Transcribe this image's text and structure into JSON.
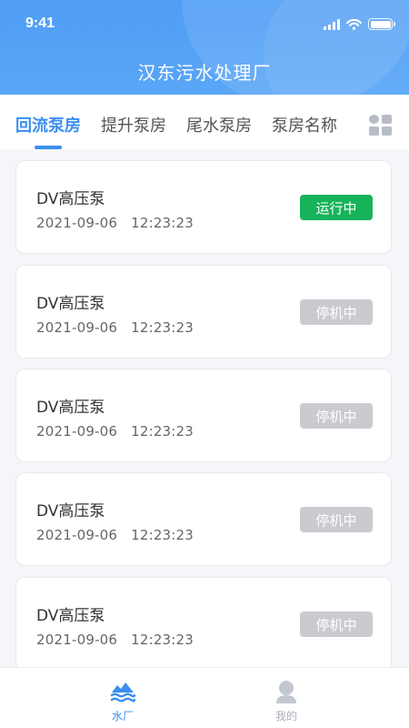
{
  "status_bar": {
    "time": "9:41"
  },
  "header": {
    "title": "汉东污水处理厂"
  },
  "tabs": [
    {
      "label": "回流泵房",
      "active": true
    },
    {
      "label": "提升泵房",
      "active": false
    },
    {
      "label": "尾水泵房",
      "active": false
    },
    {
      "label": "泵房名称",
      "active": false
    }
  ],
  "tab_menu_icon": "grid-menu-icon",
  "pumps": [
    {
      "name": "DV高压泵",
      "time": "2021-09-06   12:23:23",
      "status": "运行中",
      "running": true
    },
    {
      "name": "DV高压泵",
      "time": "2021-09-06   12:23:23",
      "status": "停机中",
      "running": false
    },
    {
      "name": "DV高压泵",
      "time": "2021-09-06   12:23:23",
      "status": "停机中",
      "running": false
    },
    {
      "name": "DV高压泵",
      "time": "2021-09-06   12:23:23",
      "status": "停机中",
      "running": false
    },
    {
      "name": "DV高压泵",
      "time": "2021-09-06   12:23:23",
      "status": "停机中",
      "running": false
    }
  ],
  "bottom_nav": [
    {
      "label": "水厂",
      "icon": "water-plant-icon",
      "active": true
    },
    {
      "label": "我的",
      "icon": "user-icon",
      "active": false
    }
  ],
  "colors": {
    "primary": "#3b8ff0",
    "running": "#17b35a",
    "stopped": "#c9cbcf",
    "nav_inactive": "#aab0b8"
  }
}
